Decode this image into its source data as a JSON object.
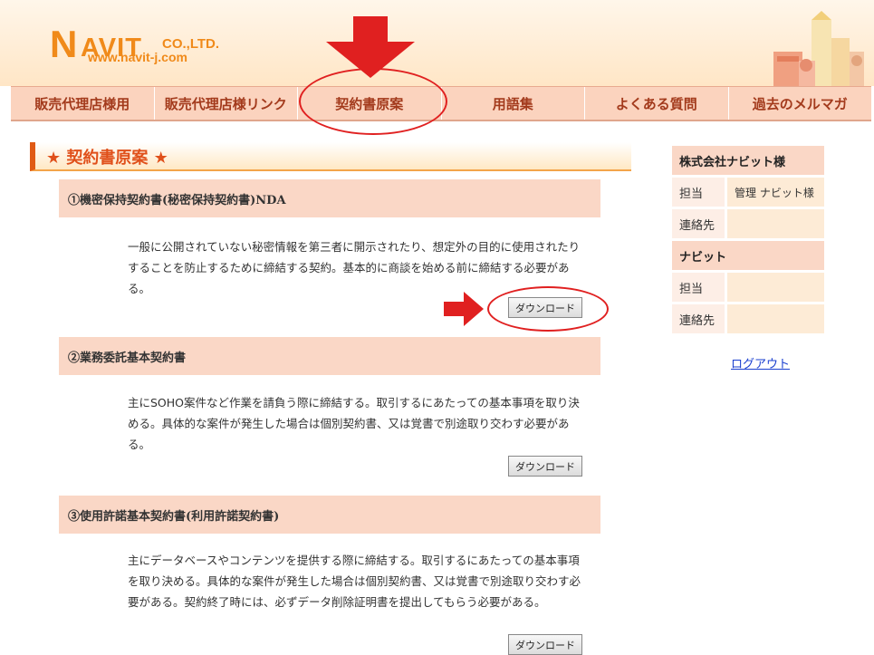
{
  "logo": {
    "letter_n": "N",
    "letters": "AVIT",
    "company": "CO.,LTD.",
    "url": "www.navit-j.com"
  },
  "nav": [
    {
      "label": "販売代理店様用"
    },
    {
      "label": "販売代理店様リンク"
    },
    {
      "label": "契約書原案"
    },
    {
      "label": "用語集"
    },
    {
      "label": "よくある質問"
    },
    {
      "label": "過去のメルマガ"
    }
  ],
  "section_title": "★ 契約書原案 ★",
  "contracts": [
    {
      "title": "①機密保持契約書(秘密保持契約書)NDA",
      "description": "一般に公開されていない秘密情報を第三者に開示されたり、想定外の目的に使用されたりすることを防止するために締結する契約。基本的に商談を始める前に締結する必要がある。",
      "button": "ダウンロード"
    },
    {
      "title": "②業務委託基本契約書",
      "description": "主にSOHO案件など作業を請負う際に締結する。取引するにあたっての基本事項を取り決める。具体的な案件が発生した場合は個別契約書、又は覚書で別途取り交わす必要がある。",
      "button": "ダウンロード"
    },
    {
      "title": "③使用許諾基本契約書(利用許諾契約書)",
      "description": "主にデータベースやコンテンツを提供する際に締結する。取引するにあたっての基本事項を取り決める。具体的な案件が発生した場合は個別契約書、又は覚書で別途取り交わす必要がある。契約終了時には、必ずデータ削除証明書を提出してもらう必要がある。",
      "button": "ダウンロード"
    }
  ],
  "sidebar": {
    "company1": "株式会社ナビット様",
    "company1_rows": [
      {
        "label": "担当",
        "value": "管理 ナビット様"
      },
      {
        "label": "連絡先",
        "value": ""
      }
    ],
    "company2": "ナビット",
    "company2_rows": [
      {
        "label": "担当",
        "value": ""
      },
      {
        "label": "連絡先",
        "value": ""
      }
    ],
    "logout": "ログアウト"
  },
  "colors": {
    "accent": "#e02020",
    "nav_bg": "#fbd3be",
    "brand": "#f08a1a"
  }
}
